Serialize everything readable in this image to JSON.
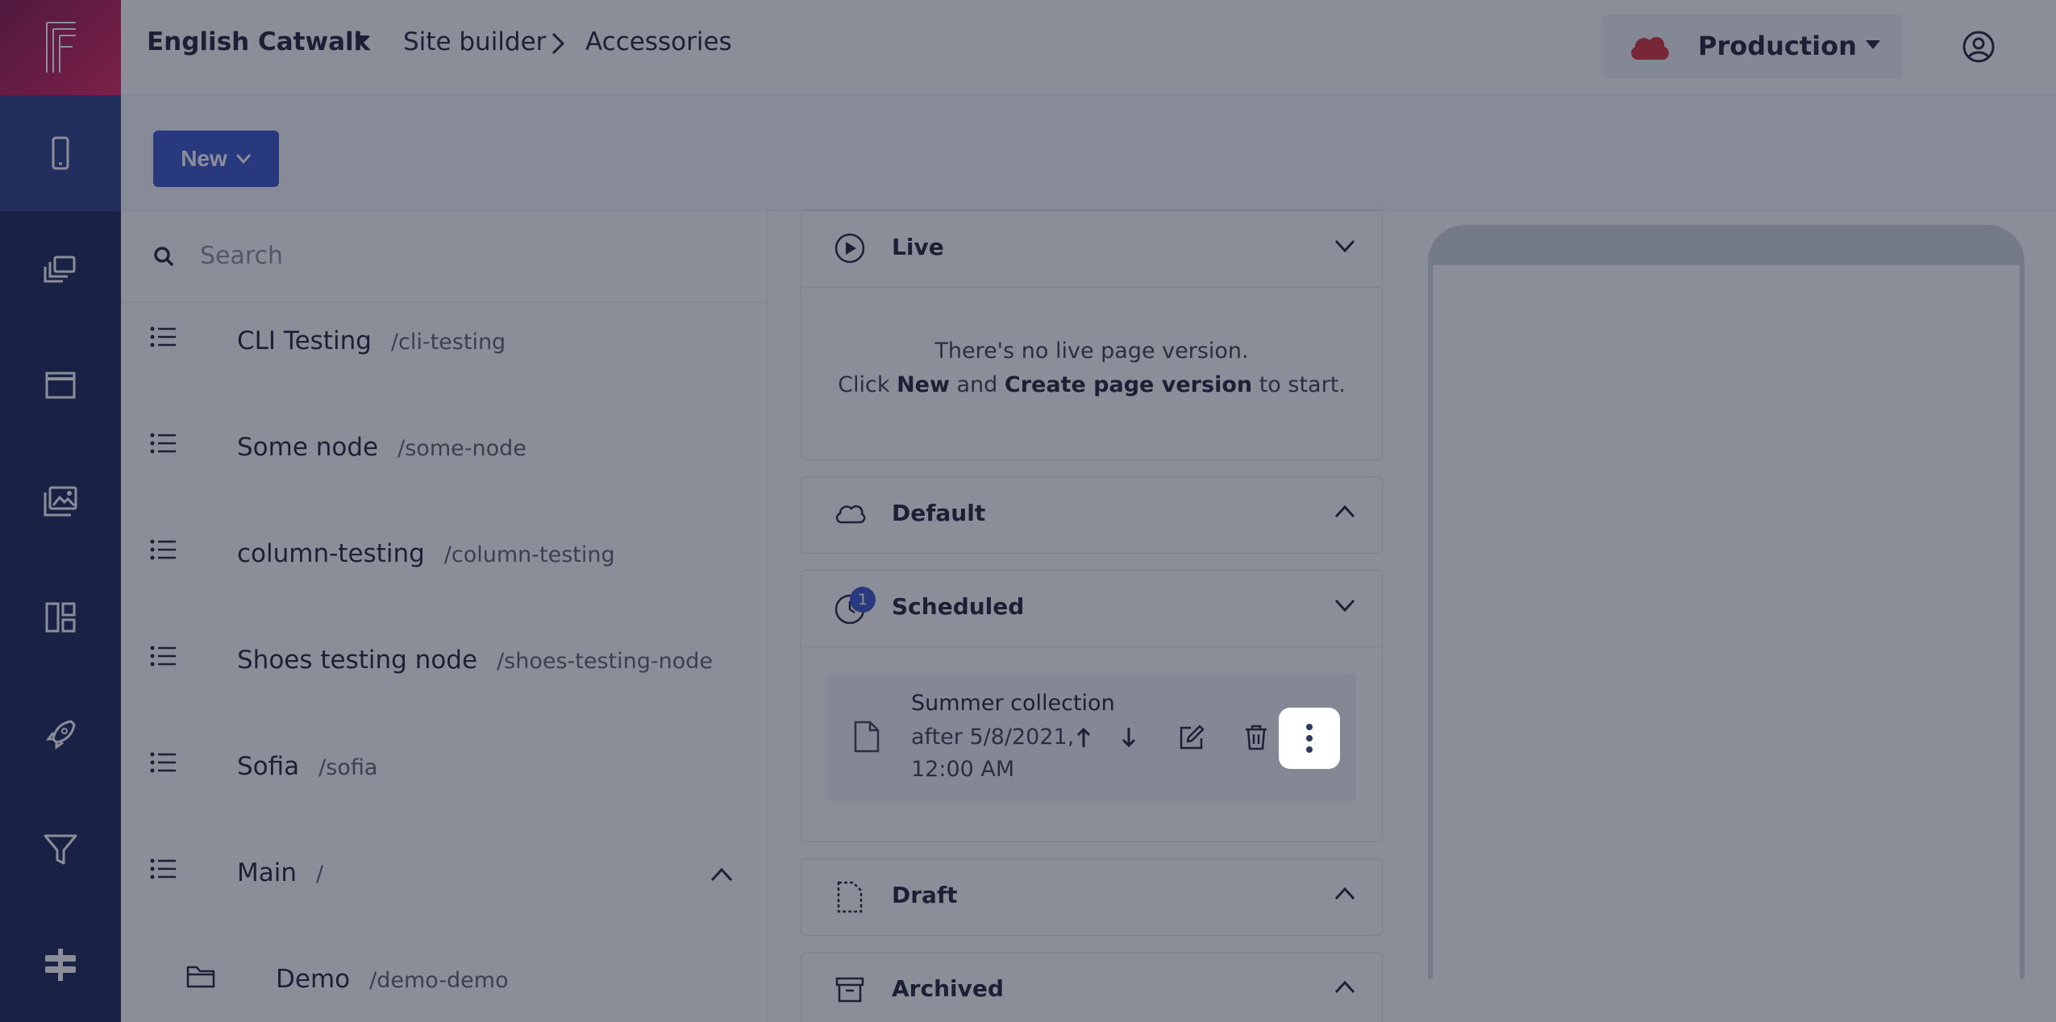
{
  "topbar": {
    "site_name": "English Catwalk",
    "breadcrumb": [
      "Site builder",
      "Accessories"
    ],
    "environment": "Production"
  },
  "toolbar": {
    "new_label": "New"
  },
  "search": {
    "placeholder": "Search"
  },
  "tree": {
    "nodes": [
      {
        "name": "CLI Testing",
        "path": "/cli-testing"
      },
      {
        "name": "Some node",
        "path": "/some-node"
      },
      {
        "name": "column-testing",
        "path": "/column-testing"
      },
      {
        "name": "Shoes testing node",
        "path": "/shoes-testing-node"
      },
      {
        "name": "Sofia",
        "path": "/sofia"
      },
      {
        "name": "Main",
        "path": "/"
      },
      {
        "name": "Demo",
        "path": "/demo-demo"
      }
    ]
  },
  "versions": {
    "live": {
      "title": "Live",
      "empty_line1": "There's no live page version.",
      "empty_click": "Click",
      "empty_new": "New",
      "empty_and": "and",
      "empty_create": "Create page version",
      "empty_to_start": "to start."
    },
    "default": {
      "title": "Default"
    },
    "scheduled": {
      "title": "Scheduled",
      "badge": "1",
      "item_title": "Summer collection",
      "item_when": "after 5/8/2021, 12:00 AM"
    },
    "draft": {
      "title": "Draft"
    },
    "archived": {
      "title": "Archived"
    }
  },
  "colors": {
    "rail": "#1a2654",
    "rail_active": "#2d3f86",
    "logo_start": "#8a1447",
    "logo_end": "#e0235f",
    "primary": "#3b55c8",
    "env_cloud": "#d6303b"
  }
}
